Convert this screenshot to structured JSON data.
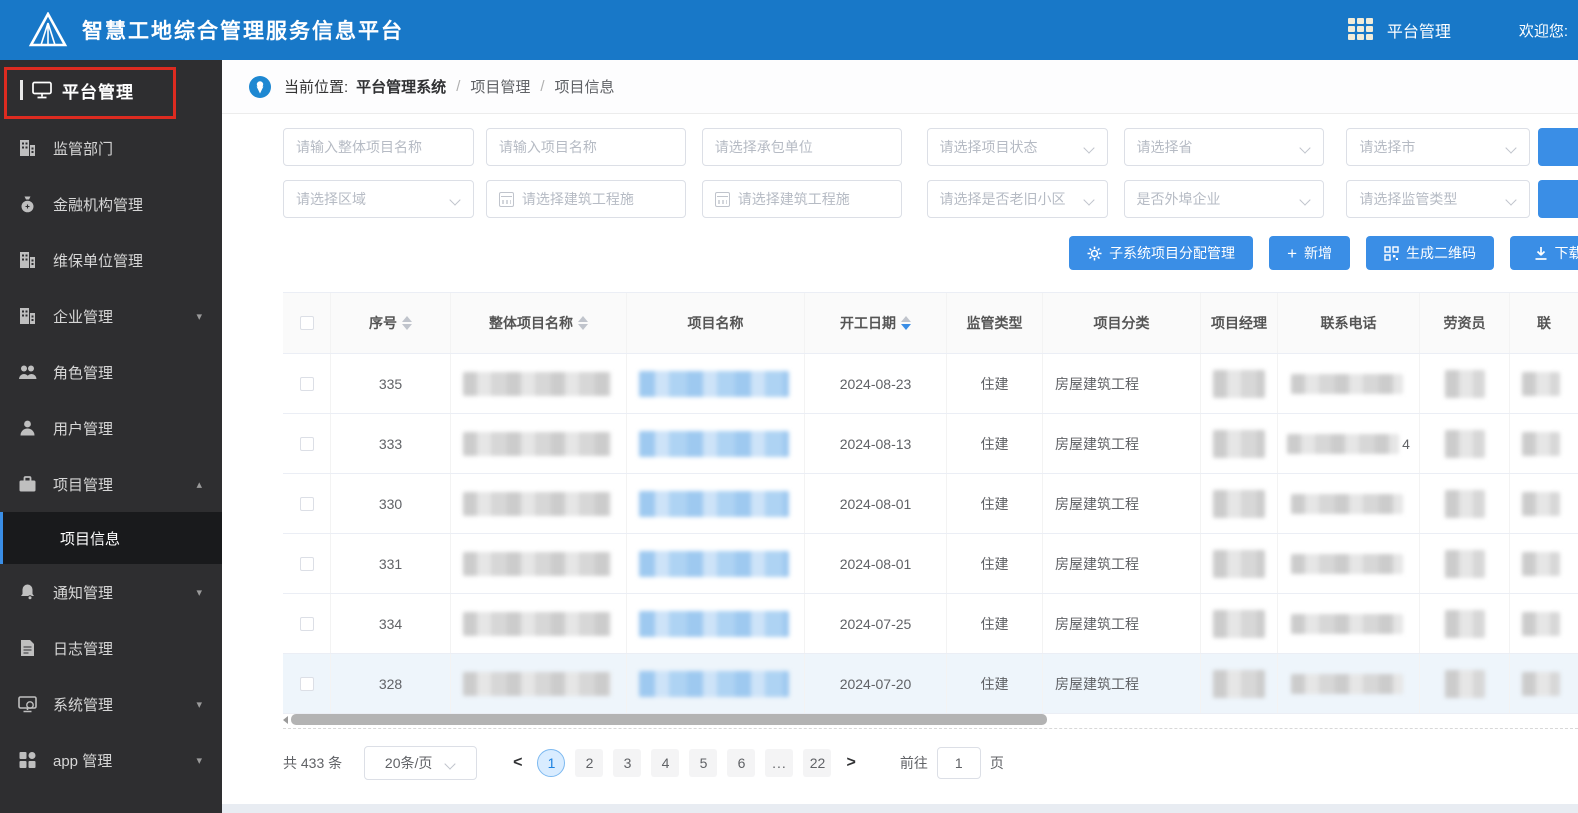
{
  "colors": {
    "header_blue": "#1878c8",
    "sidebar_bg": "#2e2e30",
    "accent": "#3a8ee6",
    "annotation_red": "#dd2b20",
    "link_blur_blue": "#9ec9f0"
  },
  "icons": {
    "logo": "pyramid-triangle",
    "apps_grid": "3x3-squares",
    "location_pin": "blue-circle-pin",
    "calendar": "css-calendar",
    "select_chevron": "css-chevron-down",
    "sidebar_chevron_down": "▾",
    "sidebar_chevron_up": "▴",
    "plus": "+",
    "gear": "svg-gear",
    "qrcode": "svg-qr",
    "download": "svg-download-arrow"
  },
  "header": {
    "title": "智慧工地综合管理服务信息平台",
    "nav_label": "平台管理",
    "welcome": "欢迎您:"
  },
  "sidebar": {
    "top_item": "平台管理",
    "items": [
      {
        "label": "监管部门",
        "chevron": ""
      },
      {
        "label": "金融机构管理",
        "chevron": ""
      },
      {
        "label": "维保单位管理",
        "chevron": ""
      },
      {
        "label": "企业管理",
        "chevron": "▾"
      },
      {
        "label": "角色管理",
        "chevron": ""
      },
      {
        "label": "用户管理",
        "chevron": ""
      },
      {
        "label": "项目管理",
        "chevron": "▴"
      },
      {
        "label": "通知管理",
        "chevron": "▾"
      },
      {
        "label": "日志管理",
        "chevron": ""
      },
      {
        "label": "系统管理",
        "chevron": "▾"
      },
      {
        "label": "app 管理",
        "chevron": "▾"
      }
    ],
    "active_sub_item": "项目信息"
  },
  "breadcrumb": {
    "prefix": "当前位置:",
    "root": "平台管理系统",
    "sep": "/",
    "section": "项目管理",
    "page": "项目信息"
  },
  "filters": {
    "row1": [
      {
        "placeholder": "请输入整体项目名称"
      },
      {
        "placeholder": "请输入项目名称"
      },
      {
        "placeholder": "请选择承包单位"
      },
      {
        "placeholder": "请选择项目状态"
      },
      {
        "placeholder": "请选择省"
      },
      {
        "placeholder": "请选择市"
      }
    ],
    "row2": [
      {
        "placeholder": "请选择区域"
      },
      {
        "placeholder": "请选择建筑工程施"
      },
      {
        "placeholder": "请选择建筑工程施"
      },
      {
        "placeholder": "请选择是否老旧小区"
      },
      {
        "placeholder": "是否外埠企业"
      },
      {
        "placeholder": "请选择监管类型"
      }
    ]
  },
  "actions": {
    "assign": "子系统项目分配管理",
    "add": "新增",
    "qrcode": "生成二维码",
    "download": "下载"
  },
  "table": {
    "columns": [
      "序号",
      "整体项目名称",
      "项目名称",
      "开工日期",
      "监管类型",
      "项目分类",
      "项目经理",
      "联系电话",
      "劳资员",
      "联"
    ],
    "rows": [
      {
        "seq": "335",
        "date": "2024-08-23",
        "type": "住建",
        "category": "房屋建筑工程",
        "phone_visible": ""
      },
      {
        "seq": "333",
        "date": "2024-08-13",
        "type": "住建",
        "category": "房屋建筑工程",
        "phone_visible": "4"
      },
      {
        "seq": "330",
        "date": "2024-08-01",
        "type": "住建",
        "category": "房屋建筑工程",
        "phone_visible": ""
      },
      {
        "seq": "331",
        "date": "2024-08-01",
        "type": "住建",
        "category": "房屋建筑工程",
        "phone_visible": ""
      },
      {
        "seq": "334",
        "date": "2024-07-25",
        "type": "住建",
        "category": "房屋建筑工程",
        "phone_visible": ""
      },
      {
        "seq": "328",
        "date": "2024-07-20",
        "type": "住建",
        "category": "房屋建筑工程",
        "phone_visible": ""
      }
    ]
  },
  "pagination": {
    "total": "共 433 条",
    "page_size": "20条/页",
    "prev": "<",
    "next": ">",
    "pages": [
      "1",
      "2",
      "3",
      "4",
      "5",
      "6",
      "...",
      "22"
    ],
    "goto_prefix": "前往",
    "goto_value": "1",
    "goto_suffix": "页"
  }
}
